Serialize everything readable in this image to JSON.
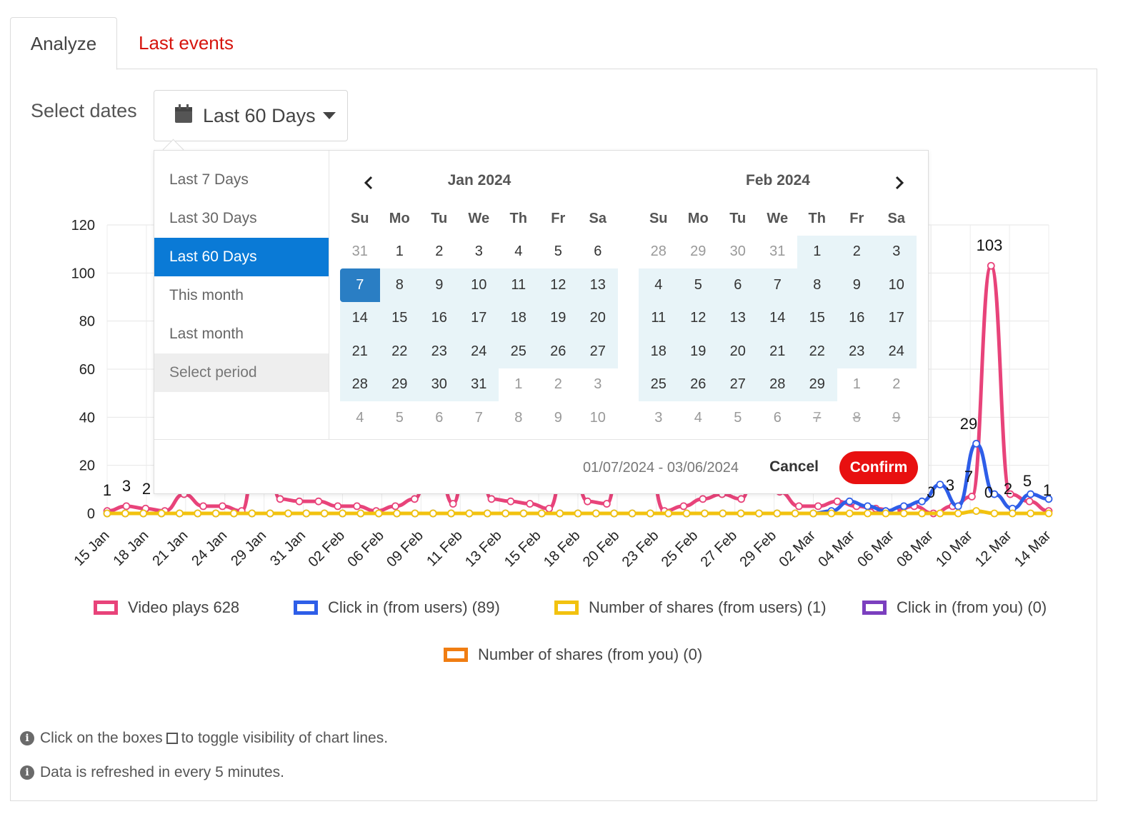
{
  "tabs": {
    "analyze": "Analyze",
    "last_events": "Last events"
  },
  "select_dates_label": "Select dates",
  "range_button": {
    "label": "Last 60 Days",
    "icon": "calendar-icon"
  },
  "ranges": [
    "Last 7 Days",
    "Last 30 Days",
    "Last 60 Days",
    "This month",
    "Last month",
    "Select period"
  ],
  "active_range": "Last 60 Days",
  "calendar": {
    "weekdays": [
      "Su",
      "Mo",
      "Tu",
      "We",
      "Th",
      "Fr",
      "Sa"
    ],
    "left": {
      "title": "Jan 2024",
      "days": [
        "31",
        "1",
        "2",
        "3",
        "4",
        "5",
        "6",
        "7",
        "8",
        "9",
        "10",
        "11",
        "12",
        "13",
        "14",
        "15",
        "16",
        "17",
        "18",
        "19",
        "20",
        "21",
        "22",
        "23",
        "24",
        "25",
        "26",
        "27",
        "28",
        "29",
        "30",
        "31",
        "1",
        "2",
        "3",
        "4",
        "5",
        "6",
        "7",
        "8",
        "9",
        "10"
      ],
      "off": [
        0,
        32,
        33,
        34,
        35,
        36,
        37,
        38,
        39,
        40,
        41
      ],
      "in_range_from": 7,
      "in_range_to": 31,
      "range_start": 7,
      "disabled": []
    },
    "right": {
      "title": "Feb 2024",
      "days": [
        "28",
        "29",
        "30",
        "31",
        "1",
        "2",
        "3",
        "4",
        "5",
        "6",
        "7",
        "8",
        "9",
        "10",
        "11",
        "12",
        "13",
        "14",
        "15",
        "16",
        "17",
        "18",
        "19",
        "20",
        "21",
        "22",
        "23",
        "24",
        "25",
        "26",
        "27",
        "28",
        "29",
        "1",
        "2",
        "3",
        "4",
        "5",
        "6",
        "7",
        "8",
        "9"
      ],
      "off": [
        0,
        1,
        2,
        3,
        33,
        34,
        35,
        36,
        37,
        38,
        39,
        40,
        41
      ],
      "in_range_from": 0,
      "in_range_to": 32,
      "range_start": -1,
      "disabled": [
        39,
        40,
        41
      ]
    },
    "date_range_text": "01/07/2024 - 03/06/2024",
    "cancel_label": "Cancel",
    "confirm_label": "Confirm"
  },
  "chart_data": {
    "type": "line",
    "ylim": [
      0,
      120
    ],
    "yticks": [
      0,
      20,
      40,
      60,
      80,
      100,
      120
    ],
    "x_tick_labels": [
      "15 Jan",
      "18 Jan",
      "21 Jan",
      "24 Jan",
      "29 Jan",
      "31 Jan",
      "02 Feb",
      "06 Feb",
      "09 Feb",
      "11 Feb",
      "13 Feb",
      "15 Feb",
      "18 Feb",
      "20 Feb",
      "23 Feb",
      "25 Feb",
      "27 Feb",
      "29 Feb",
      "02 Mar",
      "04 Mar",
      "06 Mar",
      "08 Mar",
      "10 Mar",
      "12 Mar",
      "14 Mar"
    ],
    "n_points": 49,
    "series": [
      {
        "name": "Video plays",
        "color": "#e8437a",
        "values": [
          1,
          3,
          2,
          1,
          8,
          3,
          3,
          1,
          45,
          6,
          5,
          5,
          3,
          3,
          1,
          3,
          6,
          30,
          4,
          45,
          6,
          5,
          4,
          2,
          30,
          5,
          4,
          45,
          30,
          1,
          3,
          6,
          8,
          6,
          30,
          9,
          3,
          3,
          5,
          3,
          2,
          1,
          3,
          0,
          3,
          7,
          103,
          8,
          5,
          1
        ]
      },
      {
        "name": "Click in (from users)",
        "color": "#2e5ee8",
        "values": [
          0,
          0,
          0,
          0,
          0,
          0,
          0,
          0,
          0,
          0,
          0,
          0,
          0,
          0,
          0,
          0,
          0,
          0,
          0,
          0,
          0,
          0,
          0,
          0,
          0,
          0,
          0,
          0,
          0,
          0,
          0,
          0,
          0,
          0,
          0,
          0,
          0,
          0,
          0,
          0,
          1,
          5,
          3,
          1,
          3,
          5,
          12,
          3,
          29,
          8,
          2,
          8,
          6
        ]
      },
      {
        "name": "Number of shares (from users)",
        "color": "#f2c20f",
        "values": [
          0,
          0,
          0,
          0,
          0,
          0,
          0,
          0,
          0,
          0,
          0,
          0,
          0,
          0,
          0,
          0,
          0,
          0,
          0,
          0,
          0,
          0,
          0,
          0,
          0,
          0,
          0,
          0,
          0,
          0,
          0,
          0,
          0,
          0,
          0,
          0,
          0,
          0,
          0,
          0,
          0,
          0,
          0,
          0,
          0,
          0,
          0,
          0,
          1,
          0,
          0,
          0,
          0
        ]
      },
      {
        "name": "Click in (from you)",
        "color": "#7b3fbf",
        "values": []
      },
      {
        "name": "Number of shares (from you)",
        "color": "#f07d12",
        "values": []
      }
    ],
    "data_labels": [
      "1",
      "3",
      "2",
      "103",
      "29",
      "3",
      "7",
      "0",
      "2",
      "5",
      "1",
      "0"
    ]
  },
  "legend": [
    {
      "label": "Video plays   628",
      "color": "#e8437a"
    },
    {
      "label": "Click in (from users) (89)",
      "color": "#2e5ee8"
    },
    {
      "label": "Number of shares (from users) (1)",
      "color": "#f2c20f"
    },
    {
      "label": "Click in (from you) (0)",
      "color": "#7b3fbf"
    },
    {
      "label": "Number of shares (from you) (0)",
      "color": "#f07d12"
    }
  ],
  "info": {
    "toggle_before": "Click on the boxes",
    "toggle_after": "to toggle visibility of chart lines.",
    "refresh": "Data is refreshed in every 5 minutes."
  }
}
